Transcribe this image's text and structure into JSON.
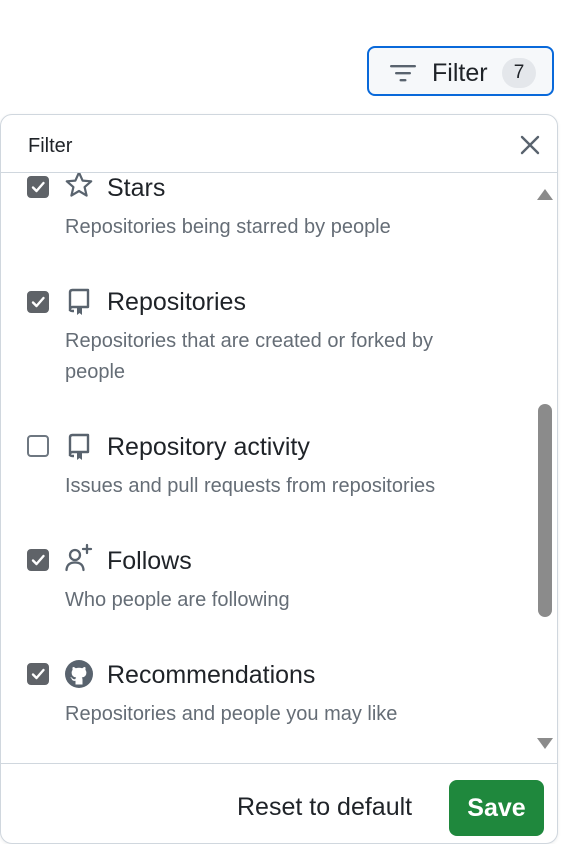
{
  "trigger": {
    "label": "Filter",
    "count": "7",
    "icon": "filter-icon",
    "accent_color": "#0969da"
  },
  "panel": {
    "title": "Filter",
    "close_icon": "close-icon"
  },
  "items": [
    {
      "title": "Stars",
      "description": "Repositories being starred by people",
      "checked": true,
      "icon": "star-icon"
    },
    {
      "title": "Repositories",
      "description": "Repositories that are created or forked by people",
      "checked": true,
      "icon": "repo-icon"
    },
    {
      "title": "Repository activity",
      "description": "Issues and pull requests from repositories",
      "checked": false,
      "icon": "repo-icon"
    },
    {
      "title": "Follows",
      "description": "Who people are following",
      "checked": true,
      "icon": "person-add-icon"
    },
    {
      "title": "Recommendations",
      "description": "Repositories and people you may like",
      "checked": true,
      "icon": "github-mark-icon"
    }
  ],
  "footer": {
    "reset_label": "Reset to default",
    "save_label": "Save",
    "save_color": "#1f883d"
  }
}
